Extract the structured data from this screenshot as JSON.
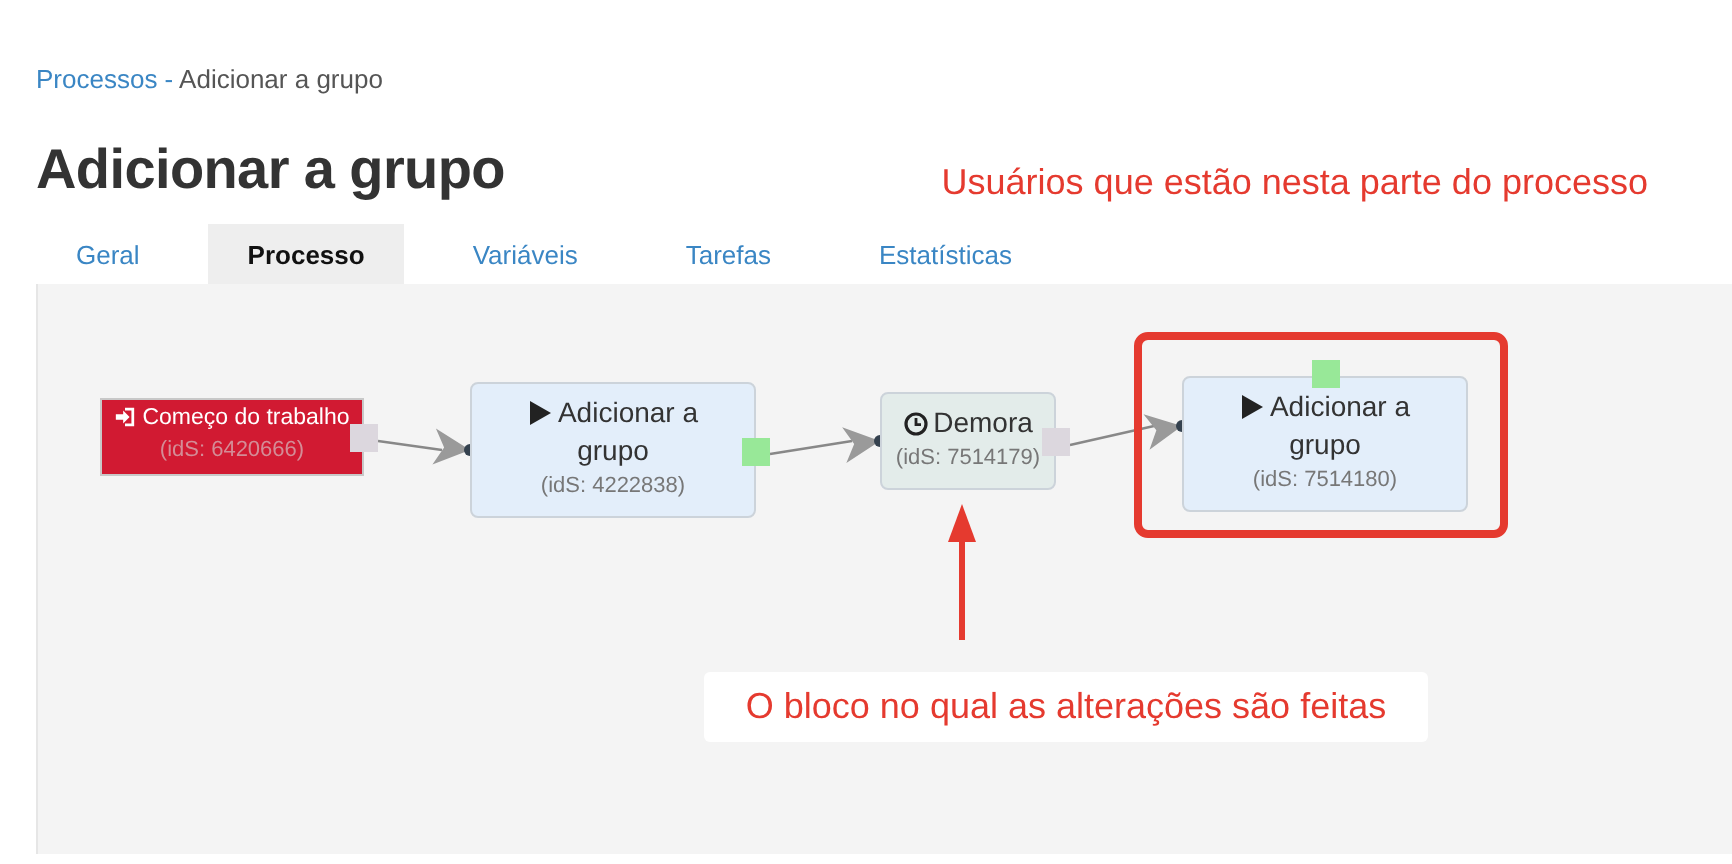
{
  "breadcrumb": [
    {
      "label": "Processos -",
      "link": true
    },
    {
      "label": "Adicionar a grupo",
      "link": false
    }
  ],
  "title": "Adicionar a grupo",
  "top_annotation": "Usuários que estão nesta parte do processo",
  "tabs": [
    {
      "label": "Geral",
      "selected": false
    },
    {
      "label": "Processo",
      "selected": true
    },
    {
      "label": "Variáveis",
      "selected": false
    },
    {
      "label": "Tarefas",
      "selected": false
    },
    {
      "label": "Estatísticas",
      "selected": false
    }
  ],
  "nodes": [
    {
      "kind": "start",
      "title": "Começo do trabalho",
      "id_text": "(idS: 6420666)",
      "highlighted": false,
      "color": "#dcd7de"
    },
    {
      "kind": "action",
      "title": "Adicionar a grupo",
      "id_text": "(idS: 4222838)",
      "highlighted": false,
      "color": "#98e898"
    },
    {
      "kind": "delay",
      "title": "Demora",
      "id_text": "(idS: 7514179)",
      "highlighted": false,
      "color": "#dcd7de"
    },
    {
      "kind": "action",
      "title": "Adicionar a grupo",
      "id_text": "(idS: 7514180)",
      "highlighted": true,
      "color": "#98e898"
    }
  ],
  "caption": "O bloco no qual as alterações são feitas"
}
